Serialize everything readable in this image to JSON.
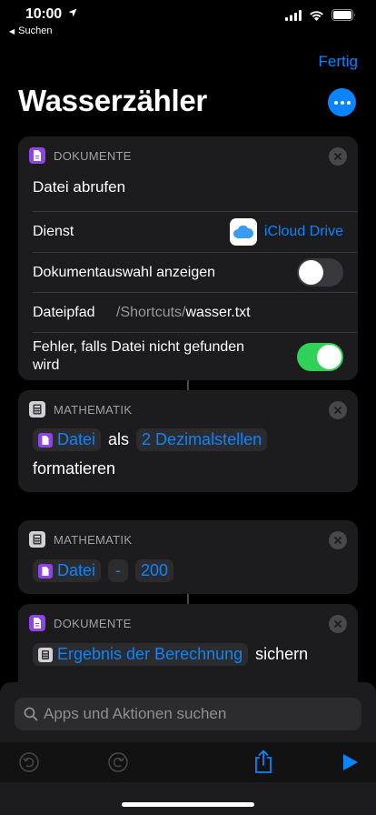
{
  "status": {
    "time": "10:00",
    "back_label": "Suchen"
  },
  "nav": {
    "done_label": "Fertig",
    "title": "Wasserzähler"
  },
  "actions": [
    {
      "category": "DOKUMENTE",
      "title": "Datei abrufen",
      "params": {
        "service_label": "Dienst",
        "service_value": "iCloud Drive",
        "picker_label": "Dokumentauswahl anzeigen",
        "picker_on": false,
        "path_label": "Dateipfad",
        "path_prefix": "/Shortcuts/",
        "path_file": "wasser.txt",
        "error_label": "Fehler, falls Datei nicht gefunden wird",
        "error_on": true
      }
    },
    {
      "category": "MATHEMATIK",
      "var": "Datei",
      "word_als": "als",
      "format": "2 Dezimalstellen",
      "word_format": "formatieren"
    },
    {
      "category": "MATHEMATIK",
      "var": "Datei",
      "operator": "-",
      "operand": "200"
    },
    {
      "category": "DOKUMENTE",
      "var": "Ergebnis der Berechnung",
      "verb": "sichern"
    }
  ],
  "search": {
    "placeholder": "Apps und Aktionen suchen"
  },
  "colors": {
    "accent": "#0a84ff",
    "toggle_on": "#30d158",
    "documents": "#8e44e6"
  }
}
